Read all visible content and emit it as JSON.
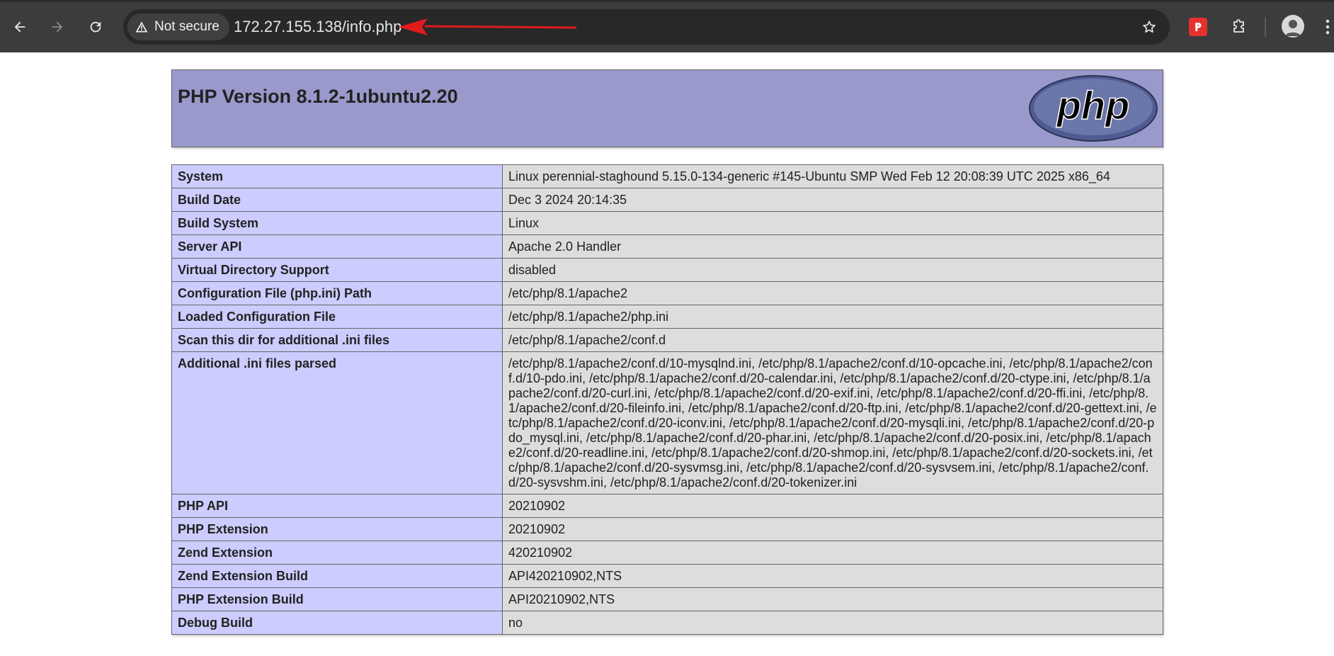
{
  "browser": {
    "security_label": "Not secure",
    "url": "172.27.155.138/info.php",
    "colors": {
      "toolbar": "#3c3c3c",
      "omnibox": "#282828",
      "arrow": "#e01b1b"
    }
  },
  "page": {
    "title": "PHP Version 8.1.2-1ubuntu2.20",
    "logo_text": "php",
    "colors": {
      "header": "#9999cc",
      "key_cell": "#ccccff",
      "value_cell": "#dddddd"
    },
    "rows": [
      {
        "key": "System",
        "value": "Linux perennial-staghound 5.15.0-134-generic #145-Ubuntu SMP Wed Feb 12 20:08:39 UTC 2025 x86_64"
      },
      {
        "key": "Build Date",
        "value": "Dec 3 2024 20:14:35"
      },
      {
        "key": "Build System",
        "value": "Linux"
      },
      {
        "key": "Server API",
        "value": "Apache 2.0 Handler"
      },
      {
        "key": "Virtual Directory Support",
        "value": "disabled"
      },
      {
        "key": "Configuration File (php.ini) Path",
        "value": "/etc/php/8.1/apache2"
      },
      {
        "key": "Loaded Configuration File",
        "value": "/etc/php/8.1/apache2/php.ini"
      },
      {
        "key": "Scan this dir for additional .ini files",
        "value": "/etc/php/8.1/apache2/conf.d"
      },
      {
        "key": "Additional .ini files parsed",
        "value": "/etc/php/8.1/apache2/conf.d/10-mysqlnd.ini, /etc/php/8.1/apache2/conf.d/10-opcache.ini, /etc/php/8.1/apache2/conf.d/10-pdo.ini, /etc/php/8.1/apache2/conf.d/20-calendar.ini, /etc/php/8.1/apache2/conf.d/20-ctype.ini, /etc/php/8.1/apache2/conf.d/20-curl.ini, /etc/php/8.1/apache2/conf.d/20-exif.ini, /etc/php/8.1/apache2/conf.d/20-ffi.ini, /etc/php/8.1/apache2/conf.d/20-fileinfo.ini, /etc/php/8.1/apache2/conf.d/20-ftp.ini, /etc/php/8.1/apache2/conf.d/20-gettext.ini, /etc/php/8.1/apache2/conf.d/20-iconv.ini, /etc/php/8.1/apache2/conf.d/20-mysqli.ini, /etc/php/8.1/apache2/conf.d/20-pdo_mysql.ini, /etc/php/8.1/apache2/conf.d/20-phar.ini, /etc/php/8.1/apache2/conf.d/20-posix.ini, /etc/php/8.1/apache2/conf.d/20-readline.ini, /etc/php/8.1/apache2/conf.d/20-shmop.ini, /etc/php/8.1/apache2/conf.d/20-sockets.ini, /etc/php/8.1/apache2/conf.d/20-sysvmsg.ini, /etc/php/8.1/apache2/conf.d/20-sysvsem.ini, /etc/php/8.1/apache2/conf.d/20-sysvshm.ini, /etc/php/8.1/apache2/conf.d/20-tokenizer.ini"
      },
      {
        "key": "PHP API",
        "value": "20210902"
      },
      {
        "key": "PHP Extension",
        "value": "20210902"
      },
      {
        "key": "Zend Extension",
        "value": "420210902"
      },
      {
        "key": "Zend Extension Build",
        "value": "API420210902,NTS"
      },
      {
        "key": "PHP Extension Build",
        "value": "API20210902,NTS"
      },
      {
        "key": "Debug Build",
        "value": "no"
      }
    ]
  }
}
